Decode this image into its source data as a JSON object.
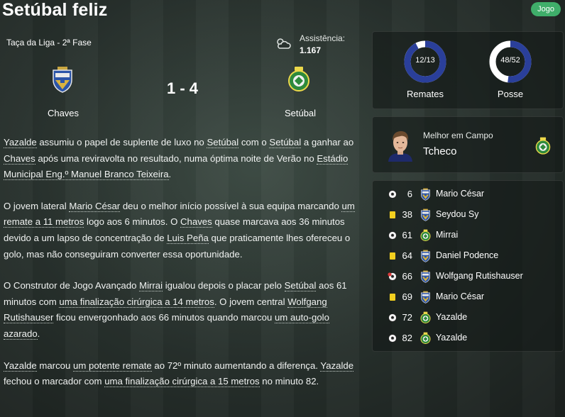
{
  "header": {
    "title": "Setúbal feliz",
    "tag": "Jogo"
  },
  "match": {
    "competition": "Taça da Liga - 2ª Fase",
    "attendance_label": "Assistência:",
    "attendance_value": "1.167",
    "weather_icon": "cloud-sun-icon",
    "score": "1 - 4",
    "home_team": "Chaves",
    "away_team": "Setúbal"
  },
  "report": {
    "p1": [
      {
        "t": "Yazalde",
        "link": true
      },
      {
        "t": " assumiu o papel de suplente de luxo no "
      },
      {
        "t": "Setúbal",
        "link": true
      },
      {
        "t": " com o "
      },
      {
        "t": "Setúbal",
        "link": true
      },
      {
        "t": " a ganhar ao "
      },
      {
        "t": "Chaves",
        "link": true
      },
      {
        "t": " após uma reviravolta no resultado, numa óptima noite de Verão no "
      },
      {
        "t": "Estádio Municipal Eng.º Manuel Branco Teixeira",
        "link": true
      },
      {
        "t": "."
      }
    ],
    "p2": [
      {
        "t": "O jovem lateral "
      },
      {
        "t": "Mario César",
        "link": true
      },
      {
        "t": " deu o melhor início possível à sua equipa marcando "
      },
      {
        "t": "um remate a 11 metros",
        "link": true
      },
      {
        "t": " logo aos 6 minutos. O "
      },
      {
        "t": "Chaves",
        "link": true
      },
      {
        "t": " quase marcava aos 36 minutos devido a um lapso de concentração de "
      },
      {
        "t": "Luis Peña",
        "link": true
      },
      {
        "t": " que praticamente lhes ofereceu o golo, mas não conseguiram converter essa oportunidade."
      }
    ],
    "p3": [
      {
        "t": "O Construtor de Jogo Avançado "
      },
      {
        "t": "Mirrai",
        "link": true
      },
      {
        "t": " igualou depois o placar pelo "
      },
      {
        "t": "Setúbal",
        "link": true
      },
      {
        "t": " aos 61 minutos com "
      },
      {
        "t": "uma finalização cirúrgica a 14 metros",
        "link": true
      },
      {
        "t": ". O jovem central "
      },
      {
        "t": "Wolfgang Rutishauser",
        "link": true
      },
      {
        "t": " ficou envergonhado aos 66 minutos quando marcou "
      },
      {
        "t": "um auto-golo azarado",
        "link": true
      },
      {
        "t": "."
      }
    ],
    "p4": [
      {
        "t": "Yazalde",
        "link": true
      },
      {
        "t": " marcou "
      },
      {
        "t": "um potente remate",
        "link": true
      },
      {
        "t": " ao 72º minuto aumentando a diferença. "
      },
      {
        "t": "Yazalde",
        "link": true
      },
      {
        "t": " fechou o marcador com "
      },
      {
        "t": "uma finalização cirúrgica a 15 metros",
        "link": true
      },
      {
        "t": " no minuto 82."
      }
    ]
  },
  "stats": {
    "shots_value": "12/13",
    "shots_fraction": 0.923,
    "shots_label": "Remates",
    "possession_value": "48/52",
    "possession_fraction": 0.52,
    "possession_label": "Posse",
    "home_color": "#2a3f9a",
    "away_color": "#ffffff"
  },
  "motm": {
    "title": "Melhor em Campo",
    "name": "Tcheco"
  },
  "events": [
    {
      "minute": "6",
      "type": "goal",
      "team": "home",
      "player": "Mario César"
    },
    {
      "minute": "38",
      "type": "yellow-card",
      "team": "home",
      "player": "Seydou Sy"
    },
    {
      "minute": "61",
      "type": "goal",
      "team": "away",
      "player": "Mirrai"
    },
    {
      "minute": "64",
      "type": "yellow-card",
      "team": "home",
      "player": "Daniel Podence"
    },
    {
      "minute": "66",
      "type": "own-goal",
      "team": "home",
      "player": "Wolfgang Rutishauser"
    },
    {
      "minute": "69",
      "type": "yellow-card",
      "team": "home",
      "player": "Mario César"
    },
    {
      "minute": "72",
      "type": "goal",
      "team": "away",
      "player": "Yazalde"
    },
    {
      "minute": "82",
      "type": "goal",
      "team": "away",
      "player": "Yazalde"
    }
  ]
}
